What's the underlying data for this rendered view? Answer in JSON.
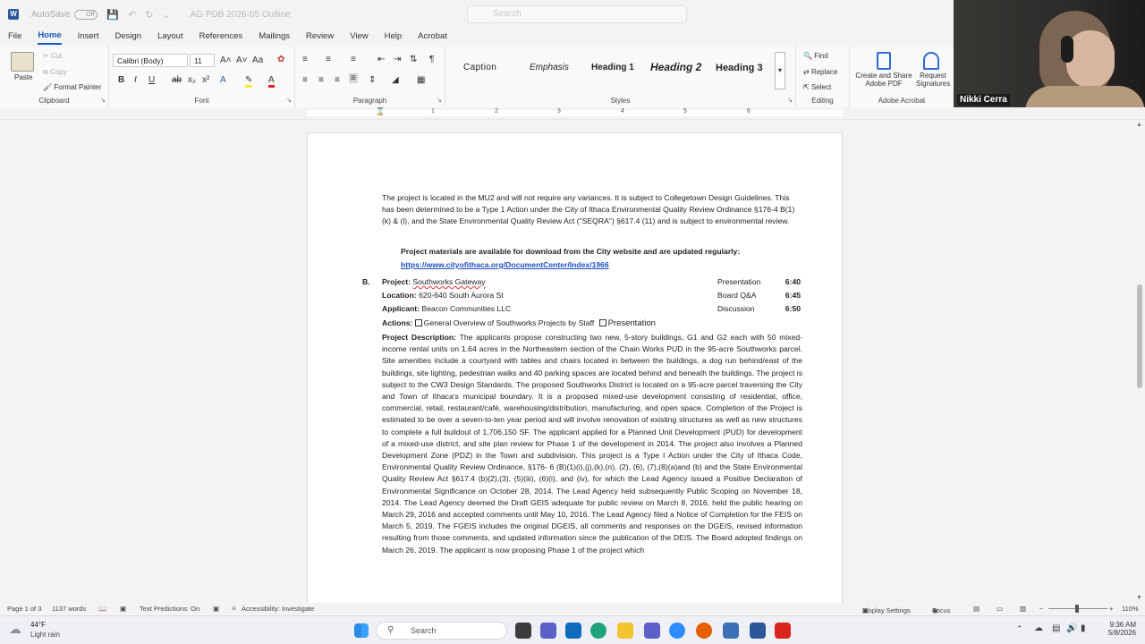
{
  "titlebar": {
    "autosave_label": "AutoSave",
    "autosave_state": "Off",
    "doc_title": "AG PDB 2026-05 Outline",
    "search_placeholder": "Search"
  },
  "menu": [
    "File",
    "Home",
    "Insert",
    "Design",
    "Layout",
    "References",
    "Mailings",
    "Review",
    "View",
    "Help",
    "Acrobat"
  ],
  "ribbon": {
    "clipboard": {
      "paste": "Paste",
      "cut": "Cut",
      "copy": "Copy",
      "format_painter": "Format Painter",
      "label": "Clipboard"
    },
    "font": {
      "name": "Calibri (Body)",
      "size": "11",
      "label": "Font"
    },
    "paragraph": {
      "label": "Paragraph"
    },
    "styles": {
      "items": [
        "Caption",
        "Emphasis",
        "Heading 1",
        "Heading 2",
        "Heading 3"
      ],
      "label": "Styles"
    },
    "editing": {
      "find": "Find",
      "replace": "Replace",
      "select": "Select",
      "label": "Editing"
    },
    "acrobat": {
      "create_share": "Create and Share Adobe PDF",
      "request_sign": "Request Signatures",
      "label": "Adobe Acrobat"
    }
  },
  "video": {
    "participant": "Nikki Cerra"
  },
  "ruler": {
    "numbers": [
      "1",
      "2",
      "3",
      "4",
      "5",
      "6"
    ]
  },
  "document": {
    "intro_para": "The project is located in the MU2 and will not require any variances. It is subject to Collegetown Design Guidelines. This has been determined to be a Type 1 Action under the City of Ithaca Environmental Quality Review Ordinance §176-4 B(1)(k) & (l), and the State Environmental Quality Review Act (\"SEQRA\") §617.4 (11) and is subject to environmental review.",
    "materials_note": "Project materials are available for download from the City website and are updated regularly:",
    "materials_link": "https://www.cityofithaca.org/DocumentCenter/Index/1966",
    "item_letter": "B.",
    "project_label": "Project:",
    "project_value": "Southworks Gateway",
    "location_label": "Location:",
    "location_value": "620-640 South Aurora St",
    "applicant_label": "Applicant:",
    "applicant_value": "Beacon Communities LLC",
    "actions_label": "Actions:",
    "action_1": "General Overview of Southworks Projects by Staff",
    "action_2": "Presentation",
    "schedule": [
      {
        "label": "Presentation",
        "time": "6:40"
      },
      {
        "label": "Board Q&A",
        "time": "6:45"
      },
      {
        "label": "Discussion",
        "time": "6:50"
      }
    ],
    "desc_label": "Project Description:",
    "description": "The applicants propose constructing two new, 5-story buildings, G1 and G2 each with 50 mixed-income rental units on 1.64 acres in the Northeastern section of the Chain Works PUD in the 95-acre Southworks parcel. Site amenities include a courtyard with tables and chairs located in between the buildings, a dog run behind/east of the buildings, site lighting, pedestrian walks and 40 parking spaces are located behind and beneath the buildings. The project is subject to the CW3 Design Standards.  The proposed Southworks District is located on a 95-acre parcel traversing the City and Town of Ithaca's municipal boundary. It is a proposed mixed-use development consisting of residential, office, commercial, retail, restaurant/café, warehousing/distribution, manufacturing, and open space. Completion of the Project is estimated to be over a seven-to-ten year period and will involve renovation of existing structures as well as new structures to complete a full buildout of 1,706,150 SF. The applicant applied for a Planned Unit Development (PUD) for development of a mixed-use district, and site plan review for Phase 1 of the development in 2014. The project also involves a Planned Development Zone (PDZ) in the Town and subdivision. This project is a Type I Action under the City of Ithaca Code, Environmental Quality Review Ordinance, §176- 6 (B)(1)(i),(j),(k),(n), (2), (6), (7),(8)(a)and (b) and the State Environmental Quality Review Act §617.4 (b)(2),(3), (5)(iii), (6)(i), and (iv), for which the Lead Agency issued a Positive Declaration of Environmental Significance on October 28, 2014. The Lead Agency held subsequently Public Scoping on November 18, 2014. The Lead Agency deemed the Draft GEIS adequate for public review on March 8, 2016, held the public hearing on March 29, 2016 and accepted comments until May 10, 2016. The Lead Agency filed a Notice of Completion for the FEIS on March 5, 2019. The FGEIS includes the original DGEIS, all comments and responses on the DGEIS, revised information resulting from those comments, and updated information since the publication of the DEIS. The Board adopted findings on March 26, 2019.  The applicant is now proposing Phase 1 of the project which"
  },
  "status": {
    "page": "Page 1 of 3",
    "words": "1137 words",
    "text_predictions": "Text Predictions: On",
    "accessibility": "Accessibility: Investigate",
    "display_settings": "Display Settings",
    "focus": "Focus",
    "zoom": "110%"
  },
  "taskbar": {
    "weather_temp": "44°F",
    "weather_desc": "Light rain",
    "search": "Search",
    "time": "9:36 AM",
    "date": "5/8/2026"
  },
  "colors": {
    "accent": "#185abd",
    "word_blue": "#2b579a",
    "link": "#1f4fc1",
    "acrobat_red": "#d9251c"
  }
}
